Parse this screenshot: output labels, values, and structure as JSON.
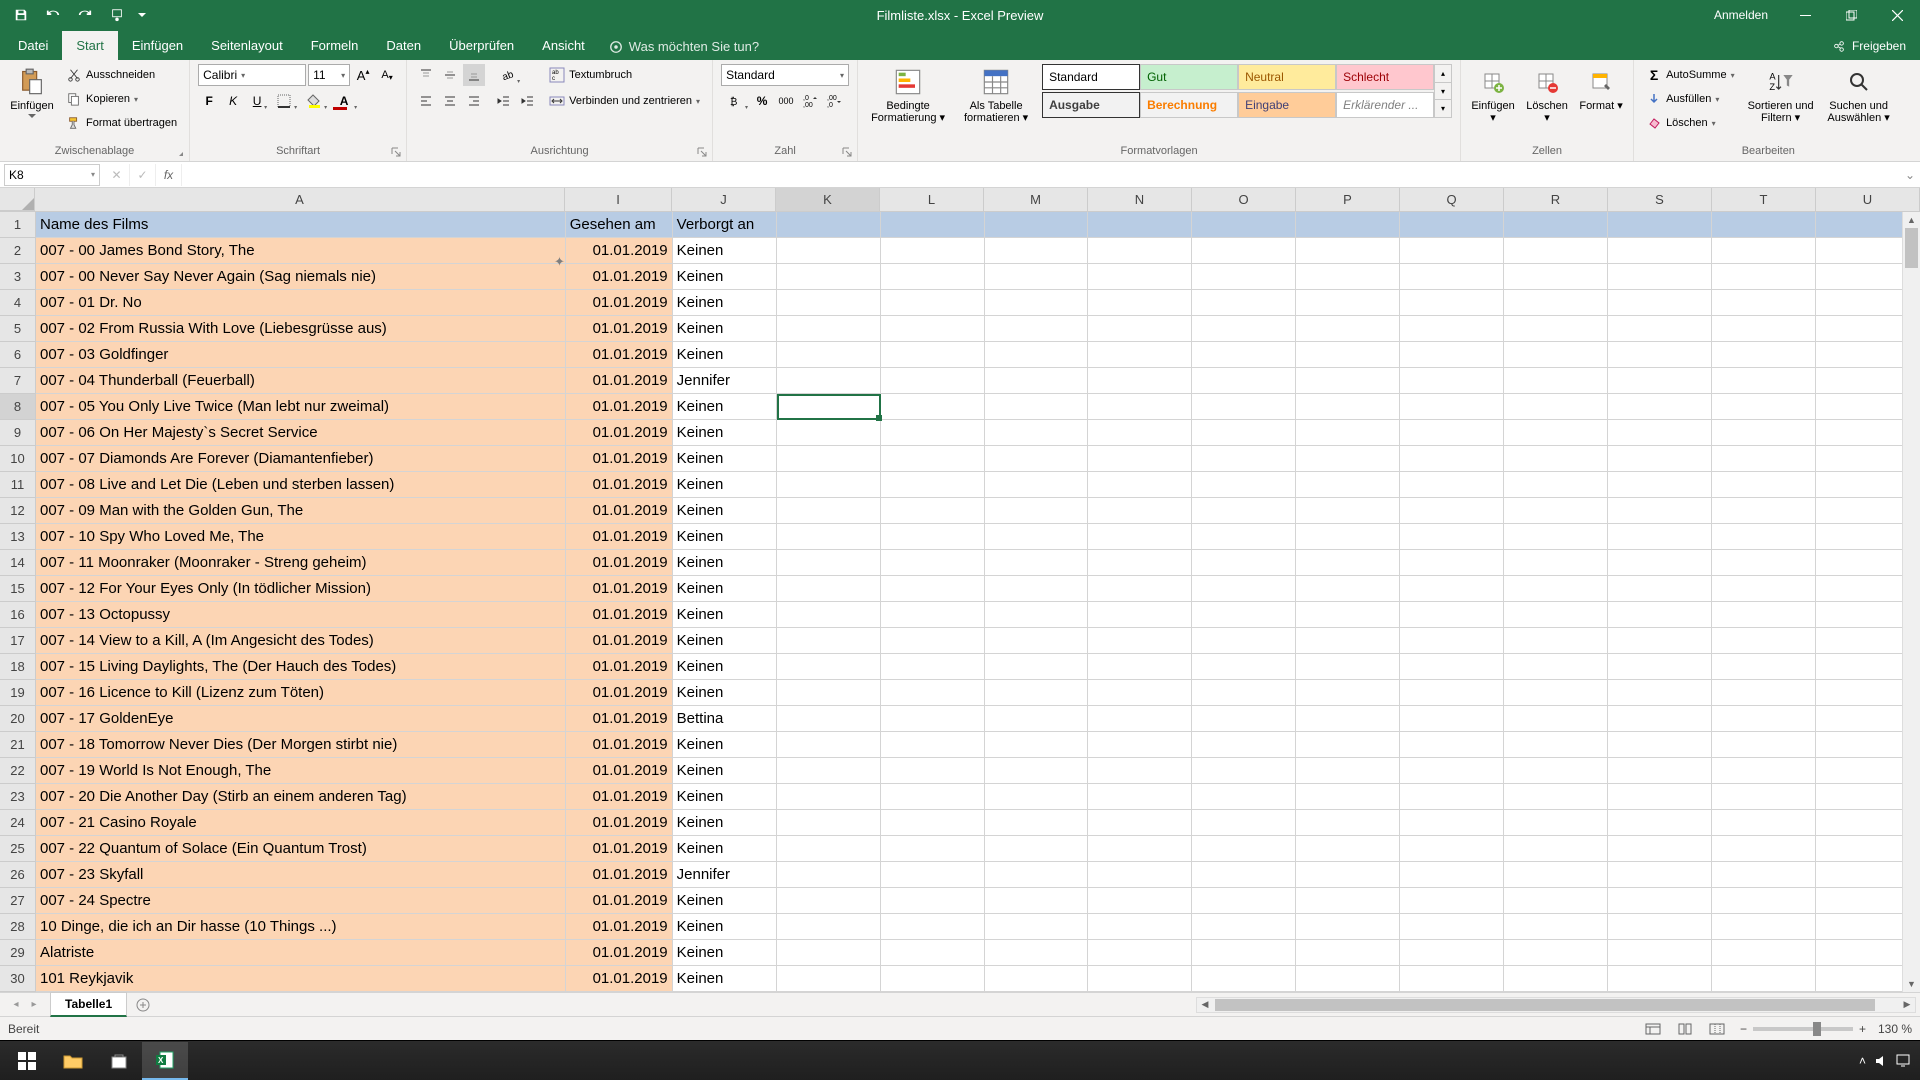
{
  "title": "Filmliste.xlsx - Excel Preview",
  "login": "Anmelden",
  "tabs": {
    "file": "Datei",
    "start": "Start",
    "einfuegen": "Einfügen",
    "seitenlayout": "Seitenlayout",
    "formeln": "Formeln",
    "daten": "Daten",
    "ueberpruefen": "Überprüfen",
    "ansicht": "Ansicht",
    "tellme": "Was möchten Sie tun?",
    "freigeben": "Freigeben"
  },
  "ribbon": {
    "clipboard": {
      "einfuegen": "Einfügen",
      "ausschneiden": "Ausschneiden",
      "kopieren": "Kopieren",
      "format": "Format übertragen",
      "label": "Zwischenablage"
    },
    "font": {
      "name": "Calibri",
      "size": "11",
      "label": "Schriftart"
    },
    "align": {
      "wrap": "Textumbruch",
      "merge": "Verbinden und zentrieren",
      "label": "Ausrichtung"
    },
    "number": {
      "format": "Standard",
      "label": "Zahl"
    },
    "styles": {
      "cond": "Bedingte Formatierung",
      "table": "Als Tabelle formatieren",
      "standard": "Standard",
      "gut": "Gut",
      "neutral": "Neutral",
      "schlecht": "Schlecht",
      "ausgabe": "Ausgabe",
      "berechnung": "Berechnung",
      "eingabe": "Eingabe",
      "erkl": "Erklärender ...",
      "label": "Formatvorlagen"
    },
    "cells": {
      "einfuegen": "Einfügen",
      "loeschen": "Löschen",
      "format": "Format",
      "label": "Zellen"
    },
    "editing": {
      "autosum": "AutoSumme",
      "fill": "Ausfüllen",
      "clear": "Löschen",
      "sort": "Sortieren und Filtern",
      "find": "Suchen und Auswählen",
      "label": "Bearbeiten"
    }
  },
  "namebox": "K8",
  "columns": [
    "A",
    "I",
    "J",
    "K",
    "L",
    "M",
    "N",
    "O",
    "P",
    "Q",
    "R",
    "S",
    "T",
    "U"
  ],
  "headers": {
    "a": "Name des Films",
    "i": "Gesehen am",
    "j": "Verborgt an"
  },
  "rows": [
    {
      "n": 2,
      "a": "007 - 00 James Bond Story, The",
      "i": "01.01.2019",
      "j": "Keinen"
    },
    {
      "n": 3,
      "a": "007 - 00 Never Say Never Again (Sag niemals nie)",
      "i": "01.01.2019",
      "j": "Keinen"
    },
    {
      "n": 4,
      "a": "007 - 01 Dr. No",
      "i": "01.01.2019",
      "j": "Keinen"
    },
    {
      "n": 5,
      "a": "007 - 02 From Russia With Love (Liebesgrüsse aus)",
      "i": "01.01.2019",
      "j": "Keinen"
    },
    {
      "n": 6,
      "a": "007 - 03 Goldfinger",
      "i": "01.01.2019",
      "j": "Keinen"
    },
    {
      "n": 7,
      "a": "007 - 04 Thunderball (Feuerball)",
      "i": "01.01.2019",
      "j": "Jennifer"
    },
    {
      "n": 8,
      "a": "007 - 05 You Only Live Twice (Man lebt nur zweimal)",
      "i": "01.01.2019",
      "j": "Keinen"
    },
    {
      "n": 9,
      "a": "007 - 06 On Her Majesty`s Secret Service",
      "i": "01.01.2019",
      "j": "Keinen"
    },
    {
      "n": 10,
      "a": "007 - 07 Diamonds Are Forever (Diamantenfieber)",
      "i": "01.01.2019",
      "j": "Keinen"
    },
    {
      "n": 11,
      "a": "007 - 08 Live and Let Die (Leben und sterben lassen)",
      "i": "01.01.2019",
      "j": "Keinen"
    },
    {
      "n": 12,
      "a": "007 - 09 Man with the Golden Gun, The",
      "i": "01.01.2019",
      "j": "Keinen"
    },
    {
      "n": 13,
      "a": "007 - 10 Spy Who Loved Me, The",
      "i": "01.01.2019",
      "j": "Keinen"
    },
    {
      "n": 14,
      "a": "007 - 11 Moonraker (Moonraker - Streng geheim)",
      "i": "01.01.2019",
      "j": "Keinen"
    },
    {
      "n": 15,
      "a": "007 - 12 For Your Eyes Only (In tödlicher Mission)",
      "i": "01.01.2019",
      "j": "Keinen"
    },
    {
      "n": 16,
      "a": "007 - 13 Octopussy",
      "i": "01.01.2019",
      "j": "Keinen"
    },
    {
      "n": 17,
      "a": "007 - 14 View to a Kill, A (Im Angesicht des Todes)",
      "i": "01.01.2019",
      "j": "Keinen"
    },
    {
      "n": 18,
      "a": "007 - 15 Living Daylights, The (Der Hauch des Todes)",
      "i": "01.01.2019",
      "j": "Keinen"
    },
    {
      "n": 19,
      "a": "007 - 16 Licence to Kill (Lizenz zum Töten)",
      "i": "01.01.2019",
      "j": "Keinen"
    },
    {
      "n": 20,
      "a": "007 - 17 GoldenEye",
      "i": "01.01.2019",
      "j": "Bettina"
    },
    {
      "n": 21,
      "a": "007 - 18 Tomorrow Never Dies (Der Morgen stirbt nie)",
      "i": "01.01.2019",
      "j": "Keinen"
    },
    {
      "n": 22,
      "a": "007 - 19 World Is Not Enough, The",
      "i": "01.01.2019",
      "j": "Keinen"
    },
    {
      "n": 23,
      "a": "007 - 20 Die Another Day (Stirb an einem anderen Tag)",
      "i": "01.01.2019",
      "j": "Keinen"
    },
    {
      "n": 24,
      "a": "007 - 21 Casino Royale",
      "i": "01.01.2019",
      "j": "Keinen"
    },
    {
      "n": 25,
      "a": "007 - 22 Quantum of Solace (Ein Quantum Trost)",
      "i": "01.01.2019",
      "j": "Keinen"
    },
    {
      "n": 26,
      "a": "007 - 23 Skyfall",
      "i": "01.01.2019",
      "j": "Jennifer"
    },
    {
      "n": 27,
      "a": "007 - 24 Spectre",
      "i": "01.01.2019",
      "j": "Keinen"
    },
    {
      "n": 28,
      "a": "10 Dinge, die ich an Dir hasse (10 Things ...)",
      "i": "01.01.2019",
      "j": "Keinen"
    },
    {
      "n": 29,
      "a": "Alatriste",
      "i": "01.01.2019",
      "j": "Keinen"
    },
    {
      "n": 30,
      "a": "101 Reykjavik",
      "i": "01.01.2019",
      "j": "Keinen"
    }
  ],
  "sheet": "Tabelle1",
  "status": "Bereit",
  "zoom": "130 %"
}
